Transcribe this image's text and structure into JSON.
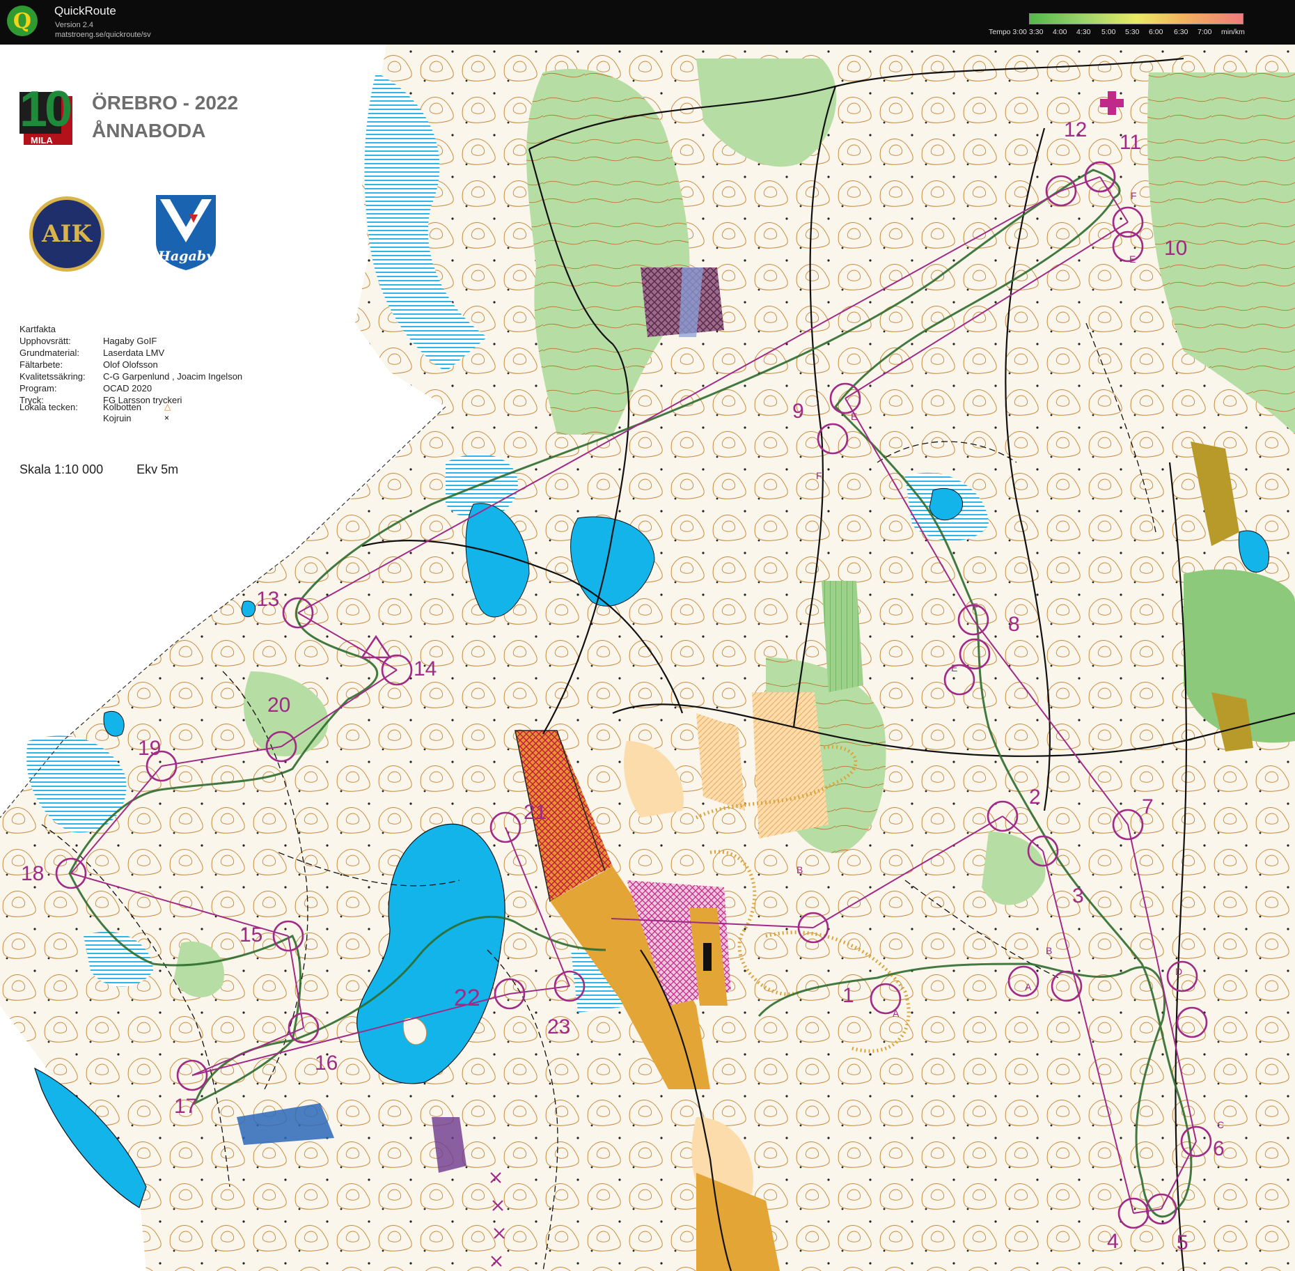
{
  "window": {
    "app_name": "QuickRoute",
    "version": "Version 2.4",
    "url": "matstroeng.se/quickroute/sv",
    "icon": "quickroute-logo-icon"
  },
  "tempo_legend": {
    "labels": [
      "Tempo 3:00",
      "3:30",
      "4:00",
      "4:30",
      "5:00",
      "5:30",
      "6:00",
      "6:30",
      "7:00",
      "min/km"
    ],
    "colors": [
      "#54b84a",
      "#9bd36b",
      "#e9ea66",
      "#f3b35e",
      "#f07c7c"
    ]
  },
  "map": {
    "event_title": "ÖREBRO - 2022",
    "event_subtitle": "ÅNNABODA",
    "logo_10mila": {
      "number": "10",
      "word": "MILA"
    },
    "logo_aik": {
      "text": "AIK"
    },
    "logo_hagaby": {
      "text": "Hagaby"
    },
    "kartfakta": {
      "heading": "Kartfakta",
      "rows": [
        {
          "label": "Upphovsrätt:",
          "value": "Hagaby GoIF"
        },
        {
          "label": "Grundmaterial:",
          "value": "Laserdata LMV"
        },
        {
          "label": "Fältarbete:",
          "value": "Olof Olofsson"
        },
        {
          "label": "Kvalitetssäkring:",
          "value": "C-G Garpenlund , Joacim Ingelson"
        },
        {
          "label": "Program:",
          "value": "OCAD 2020"
        },
        {
          "label": "Tryck:",
          "value": "FG Larsson tryckeri"
        }
      ],
      "local_symbols_label": "Lokala tecken:",
      "local_symbols": [
        {
          "name": "Kolbotten",
          "symbol": "△",
          "color": "#e07b1a"
        },
        {
          "name": "Kojruin",
          "symbol": "×",
          "color": "#000000"
        }
      ]
    },
    "scale": "Skala 1:10 000",
    "equidistance": "Ekv 5m",
    "controls": [
      "1",
      "2",
      "3",
      "4",
      "5",
      "6",
      "7",
      "8",
      "9",
      "10",
      "11",
      "12",
      "13",
      "14",
      "15",
      "16",
      "17",
      "18",
      "19",
      "20",
      "21",
      "22",
      "23"
    ],
    "control_letters": [
      "A",
      "B",
      "C",
      "D",
      "E",
      "F"
    ],
    "colors": {
      "course": "#a02a86",
      "water": "#13b4ea",
      "marsh": "#2fb6e6",
      "forest_green": "#8cc97a",
      "contour": "#b8742a",
      "open_land": "#f6c97b",
      "built_area": "#e4a537",
      "out_of_bounds": "#8a3a6a"
    }
  }
}
